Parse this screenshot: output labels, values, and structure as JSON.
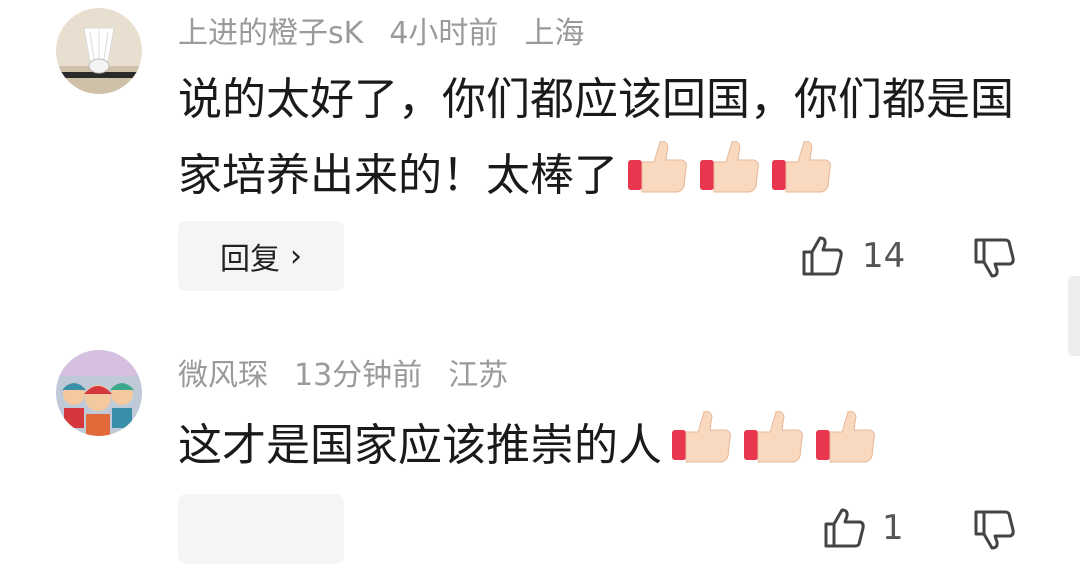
{
  "comments": [
    {
      "username": "上进的橙子sK",
      "time": "4小时前",
      "location": "上海",
      "text": "说的太好了，你们都应该回国，你们都是国家培养出来的！太棒了",
      "emojis": [
        "thumbs-up",
        "thumbs-up",
        "thumbs-up"
      ],
      "reply_label": "回复",
      "like_count": "14"
    },
    {
      "username": "微风琛",
      "time": "13分钟前",
      "location": "江苏",
      "text": "这才是国家应该推崇的人",
      "emojis": [
        "thumbs-up",
        "thumbs-up",
        "thumbs-up"
      ],
      "reply_label": "",
      "like_count": "1"
    }
  ],
  "colors": {
    "meta": "#9a9a9a",
    "text": "#1a1a1a",
    "reply_bg": "#f5f5f5",
    "emoji_cuff": "#e8364e",
    "emoji_hand": "#f8d9c0"
  }
}
